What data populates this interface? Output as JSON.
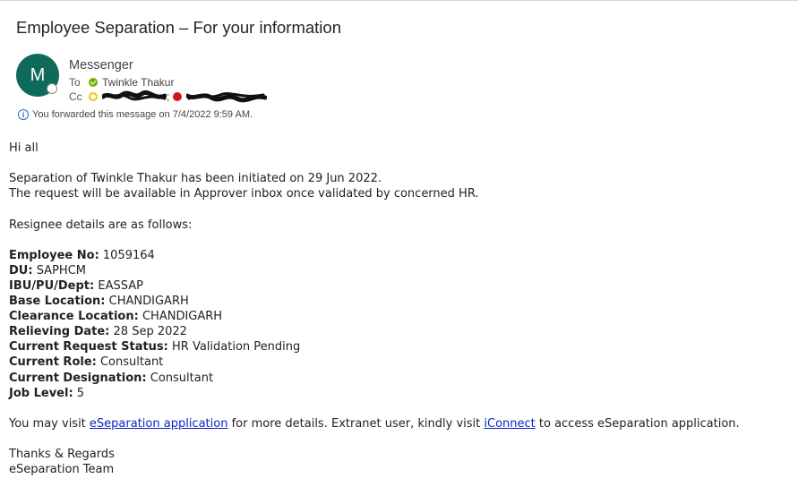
{
  "email": {
    "subject": "Employee Separation – For your information",
    "sender": {
      "initial": "M",
      "name": "Messenger"
    },
    "to_label": "To",
    "to_name": "Twinkle Thakur",
    "cc_label": "Cc",
    "cc_separator": ";",
    "info_text": "You forwarded this message on 7/4/2022 9:59 AM."
  },
  "body": {
    "greeting": "Hi all",
    "line1": "Separation of Twinkle Thakur has been initiated on 29 Jun 2022.",
    "line2": "The request will be available in Approver inbox once validated by concerned HR.",
    "details_intro": "Resignee details are as follows:",
    "details": [
      {
        "label": "Employee No:",
        "value": "1059164"
      },
      {
        "label": "DU:",
        "value": "SAPHCM"
      },
      {
        "label": "IBU/PU/Dept:",
        "value": "EASSAP"
      },
      {
        "label": "Base Location:",
        "value": "CHANDIGARH"
      },
      {
        "label": "Clearance Location:",
        "value": "CHANDIGARH"
      },
      {
        "label": "Relieving Date:",
        "value": "28 Sep 2022"
      },
      {
        "label": "Current Request Status:",
        "value": "HR Validation Pending"
      },
      {
        "label": "Current Role:",
        "value": "Consultant"
      },
      {
        "label": "Current Designation:",
        "value": "Consultant"
      },
      {
        "label": "Job Level:",
        "value": "5"
      }
    ],
    "visit_pre": "You may visit ",
    "link1": "eSeparation application",
    "visit_mid": " for more details. Extranet user, kindly visit ",
    "link2": "iConnect",
    "visit_post": " to access eSeparation application.",
    "signoff": "Thanks & Regards",
    "team": "eSeparation Team"
  },
  "colors": {
    "avatar_bg": "#0f6a5a",
    "link": "#0b23c9",
    "presence_available": "#6bb700",
    "presence_away": "#f8c40b",
    "presence_busy": "#d9121a"
  },
  "icons": [
    "info-icon",
    "presence-available-icon",
    "presence-away-icon",
    "presence-busy-icon",
    "presence-offline-icon"
  ]
}
